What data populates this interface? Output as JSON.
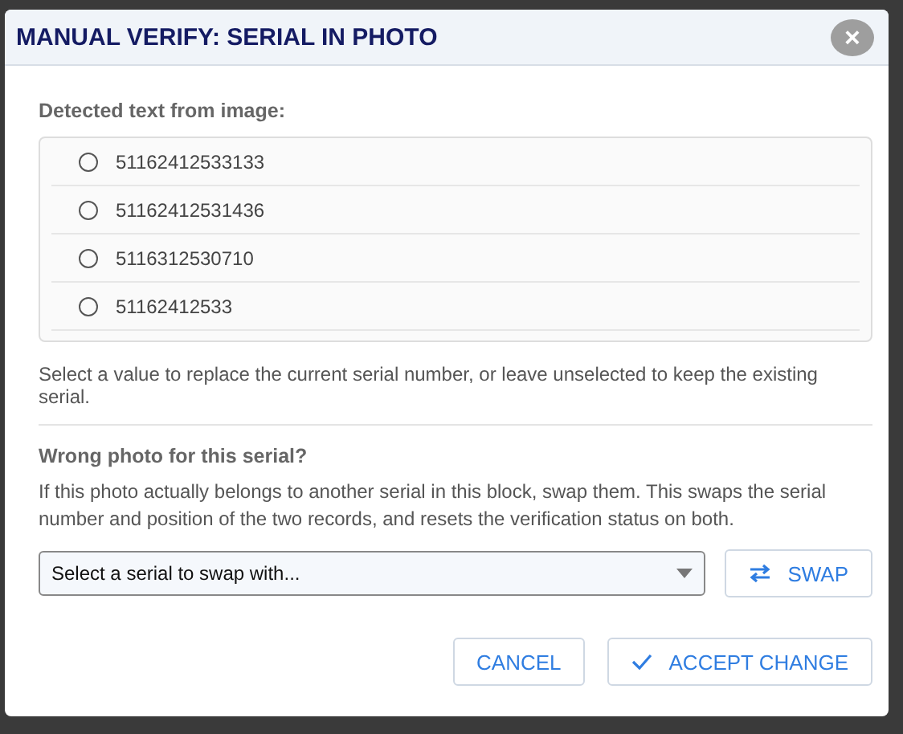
{
  "dialog": {
    "title": "MANUAL VERIFY: SERIAL IN PHOTO",
    "close": "×"
  },
  "detected": {
    "heading": "Detected text from image:",
    "options": [
      {
        "label": "51162412533133",
        "selected": false
      },
      {
        "label": "51162412531436",
        "selected": false
      },
      {
        "label": "5116312530710",
        "selected": false
      },
      {
        "label": "51162412533",
        "selected": false
      }
    ],
    "hint": "Select a value to replace the current serial number, or leave unselected to keep the existing serial."
  },
  "swap": {
    "heading": "Wrong photo for this serial?",
    "description": "If this photo actually belongs to another serial in this block, swap them. This swaps the serial number and position of the two records, and resets the verification status on both.",
    "select": {
      "placeholder": "Select a serial to swap with..."
    },
    "button": "SWAP"
  },
  "buttons": [
    {
      "kind": "cancel",
      "label": "CANCEL"
    },
    {
      "kind": "accept",
      "label": "ACCEPT CHANGE"
    }
  ]
}
